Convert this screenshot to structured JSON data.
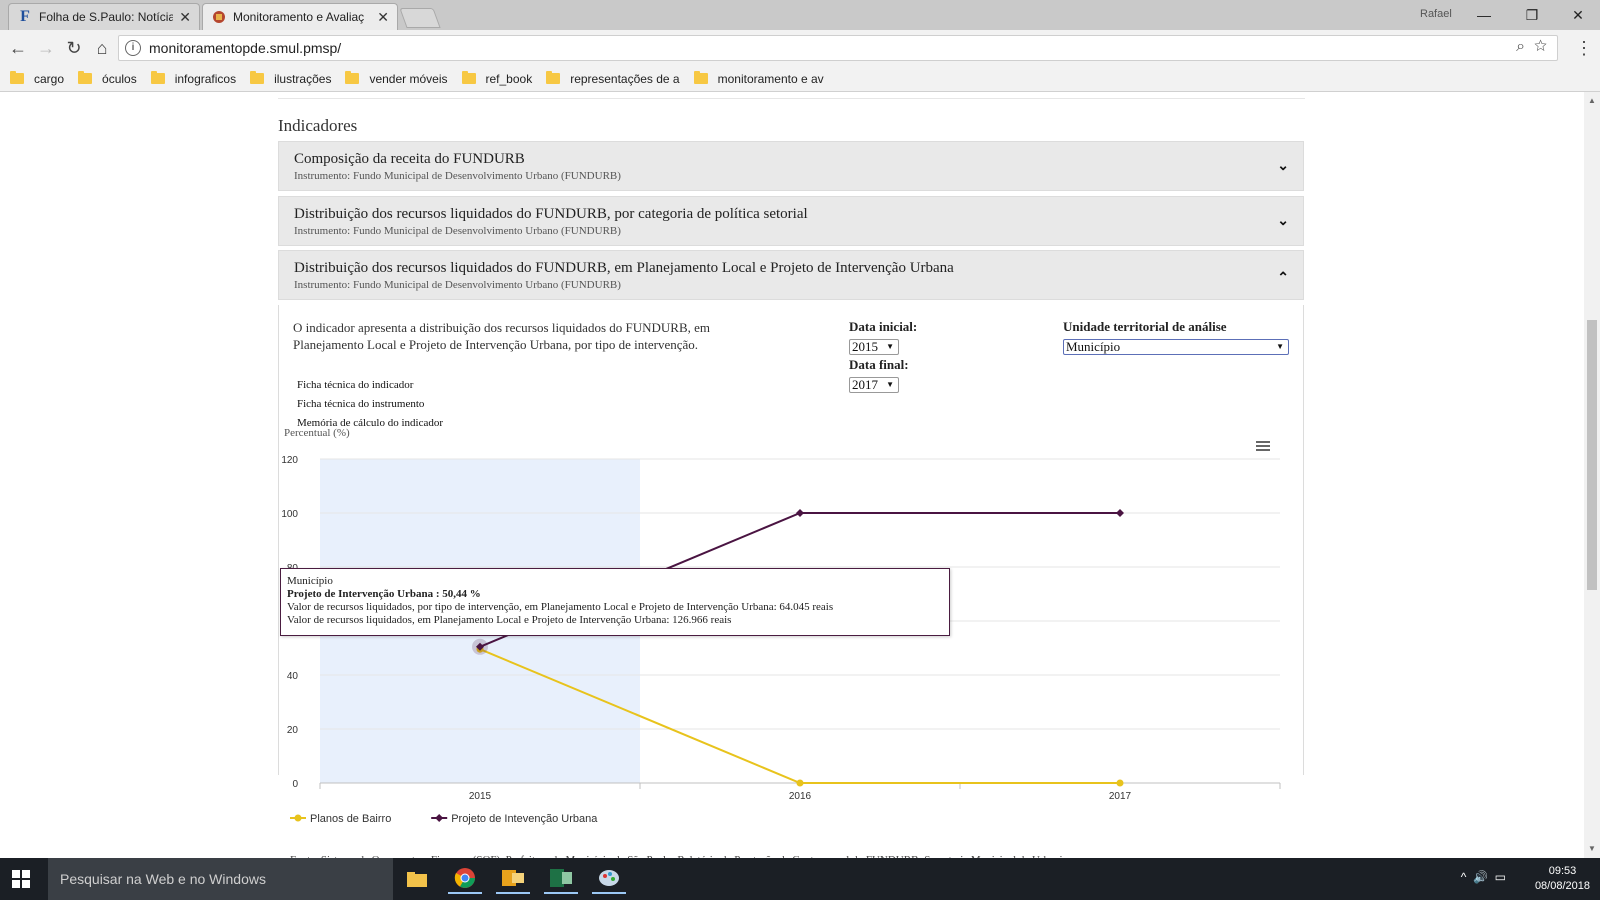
{
  "browser": {
    "tabs": [
      {
        "title": "Folha de S.Paulo: Notícias",
        "favicon": "F"
      },
      {
        "title": "Monitoramento e Avaliaç"
      }
    ],
    "profile": "Rafael",
    "url": "monitoramentopde.smul.pmsp/",
    "bookmarks": [
      "cargo",
      "óculos",
      "infograficos",
      "ilustrações",
      "vender móveis",
      "ref_book",
      "representações de a",
      "monitoramento e av"
    ]
  },
  "page": {
    "section_title": "Indicadores",
    "accordions": [
      {
        "title": "Composição da receita do FUNDURB",
        "subtitle": "Instrumento: Fundo Municipal de Desenvolvimento Urbano (FUNDURB)"
      },
      {
        "title": "Distribuição dos recursos liquidados do FUNDURB, por categoria de política setorial",
        "subtitle": "Instrumento: Fundo Municipal de Desenvolvimento Urbano (FUNDURB)"
      },
      {
        "title": "Distribuição dos recursos liquidados do FUNDURB, em Planejamento Local e Projeto de Intervenção Urbana",
        "subtitle": "Instrumento: Fundo Municipal de Desenvolvimento Urbano (FUNDURB)"
      }
    ],
    "description": "O indicador apresenta a distribuição dos recursos liquidados do FUNDURB, em Planejamento Local e Projeto de Intervenção Urbana, por tipo de intervenção.",
    "links": [
      "Ficha técnica do indicador",
      "Ficha técnica do instrumento",
      "Memória de cálculo do indicador"
    ],
    "filters": {
      "data_inicial_label": "Data inicial:",
      "data_inicial_value": "2015",
      "data_final_label": "Data final:",
      "data_final_value": "2017",
      "unidade_label": "Unidade territorial de análise",
      "unidade_value": "Município"
    },
    "tooltip": {
      "header": "Município",
      "series_line": "Projeto de Intervenção Urbana : 50,44 %",
      "line1": "Valor de recursos liquidados, por tipo de intervenção, em Planejamento Local e Projeto de Intervenção Urbana: 64.045 reais",
      "line2": "Valor de recursos liquidados, em Planejamento Local e Projeto de Intervenção Urbana: 126.966 reais"
    },
    "footer_source": "Fonte: Sistema de Orçamento e Finanças (SOF), Prefeitura do Município de São Paulo; Relatório de Prestação de Contas anual do FUNDURB; Secretaria Municipal de Urbanismo"
  },
  "chart_data": {
    "type": "line",
    "ylabel": "Percentual (%)",
    "categories": [
      "2015",
      "2016",
      "2017"
    ],
    "ylim": [
      0,
      120
    ],
    "yticks": [
      0,
      20,
      40,
      60,
      80,
      100,
      120
    ],
    "grid": true,
    "legend_position": "bottom-left",
    "series": [
      {
        "name": "Planos de Bairro",
        "values": [
          49.56,
          0,
          0
        ],
        "color": "#e8c31c"
      },
      {
        "name": "Projeto de Intevenção Urbana",
        "values": [
          50.44,
          100,
          100
        ],
        "color": "#4a1442"
      }
    ],
    "highlight_category": "2015"
  },
  "taskbar": {
    "search_placeholder": "Pesquisar na Web e no Windows",
    "time": "09:53",
    "date": "08/08/2018"
  }
}
